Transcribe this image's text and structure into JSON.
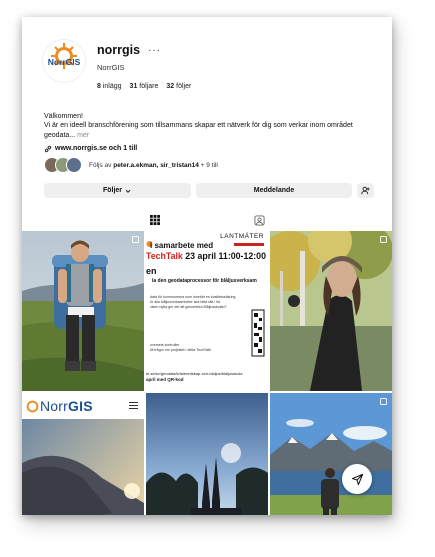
{
  "profile": {
    "username": "norrgis",
    "more_icon": "···",
    "full_name": "NorrGIS",
    "stats": {
      "posts_value": "8",
      "posts_label": "inlägg",
      "followers_value": "31",
      "followers_label": "följare",
      "following_value": "32",
      "following_label": "följer"
    },
    "bio_line1": "Välkommen!",
    "bio_line2": "Vi är en ideell branschförening som tillsammans skapar ett nätverk för dig som verkar inom området",
    "bio_line3": "geodata...",
    "bio_more": "mer",
    "link_text": "www.norrgis.se och 1 till"
  },
  "followers": {
    "prefix": "Följs av",
    "names": "peter.a.ekman, sir_tristan14",
    "suffix": "+ 9 till"
  },
  "buttons": {
    "follow": "Följer",
    "message": "Meddelande"
  },
  "logo": {
    "text_light": "Norr",
    "text_bold": "GIS"
  },
  "posts": {
    "techtalk": {
      "lantmateriet": "LANTMÄTER",
      "samarbete": "i samarbete med",
      "techtalk_red": "TechTalk",
      "techtalk_rest": " 23 april 11:00-12:00",
      "heading": "en",
      "subheading": "la den geodataprocessor för blåljusverksam",
      "body": "data för kommunerna som innebär en kvalitetssäkring\nör alla blåljusverksamheter ska hitta rätt i tid\nviken nytta ger det att genomföra Blåljusskolan?",
      "body2": "oversets kontroller\ntill frågor om projektet i detta TechTalk!",
      "footer1": "et.se/sv/geodata/kristeredskap-och-blaljus/blaljusskola",
      "footer2": "april med QR-kod"
    },
    "norrgis_bar": {
      "text_light": "Norr",
      "text_bold": "GIS"
    }
  },
  "colors": {
    "brand_blue": "#1b4f8f",
    "brand_orange": "#f08a1c",
    "techtalk_red": "#c9241b",
    "button_bg": "#efefef"
  },
  "icons": {
    "more": "more-horizontal-icon",
    "link": "link-icon",
    "chevron": "chevron-down-icon",
    "add_user": "add-user-icon",
    "grid": "grid-icon",
    "tagged": "tagged-icon",
    "multi": "multi-post-icon",
    "share": "paper-plane-icon"
  }
}
